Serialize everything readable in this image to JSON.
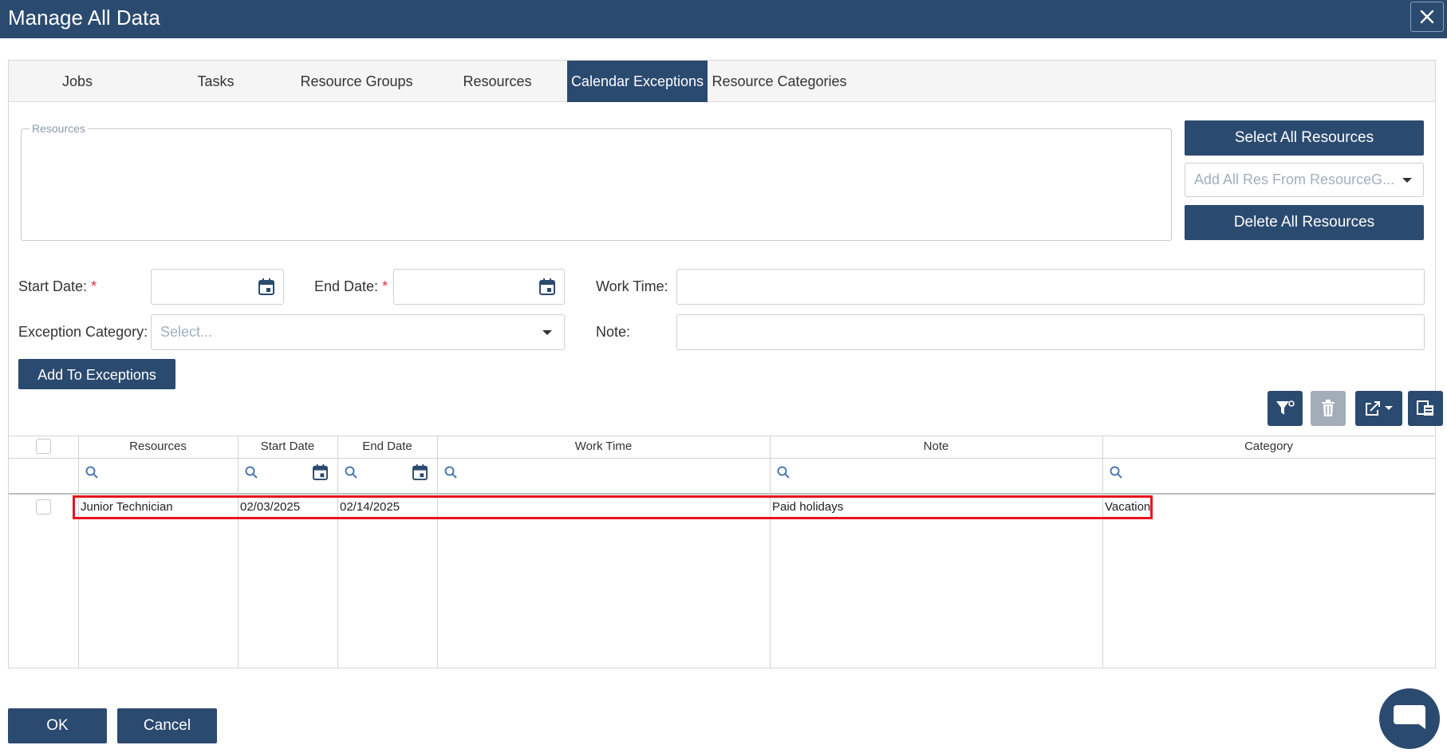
{
  "window": {
    "title": "Manage All Data",
    "close_icon": "close-icon"
  },
  "tabs": [
    {
      "label": "Jobs"
    },
    {
      "label": "Tasks"
    },
    {
      "label": "Resource Groups"
    },
    {
      "label": "Resources"
    },
    {
      "label": "Calendar Exceptions",
      "active": true
    },
    {
      "label": "Resource Categories"
    }
  ],
  "resources_box": {
    "legend": "Resources"
  },
  "actions": {
    "select_all": "Select All Resources",
    "add_from_group_placeholder": "Add All Res From ResourceG...",
    "delete_all": "Delete All Resources"
  },
  "form": {
    "start_date_label": "Start Date:",
    "end_date_label": "End Date:",
    "work_time_label": "Work Time:",
    "exception_category_label": "Exception Category:",
    "exception_category_placeholder": "Select...",
    "note_label": "Note:",
    "required_mark": "*",
    "add_button": "Add To Exceptions"
  },
  "toolbar": {
    "icons": [
      "filter-icon",
      "trash-icon",
      "export-icon",
      "column-chooser-icon"
    ]
  },
  "grid": {
    "columns": [
      "Resources",
      "Start Date",
      "End Date",
      "Work Time",
      "Note",
      "Category"
    ],
    "rows": [
      {
        "resource": "Junior Technician",
        "start": "02/03/2025",
        "end": "02/14/2025",
        "work_time": "",
        "note": "Paid holidays",
        "category": "Vacation"
      }
    ]
  },
  "footer": {
    "ok": "OK",
    "cancel": "Cancel"
  },
  "colors": {
    "primary": "#2b4a6f",
    "highlight": "#e8141c",
    "required": "#d9363e"
  }
}
